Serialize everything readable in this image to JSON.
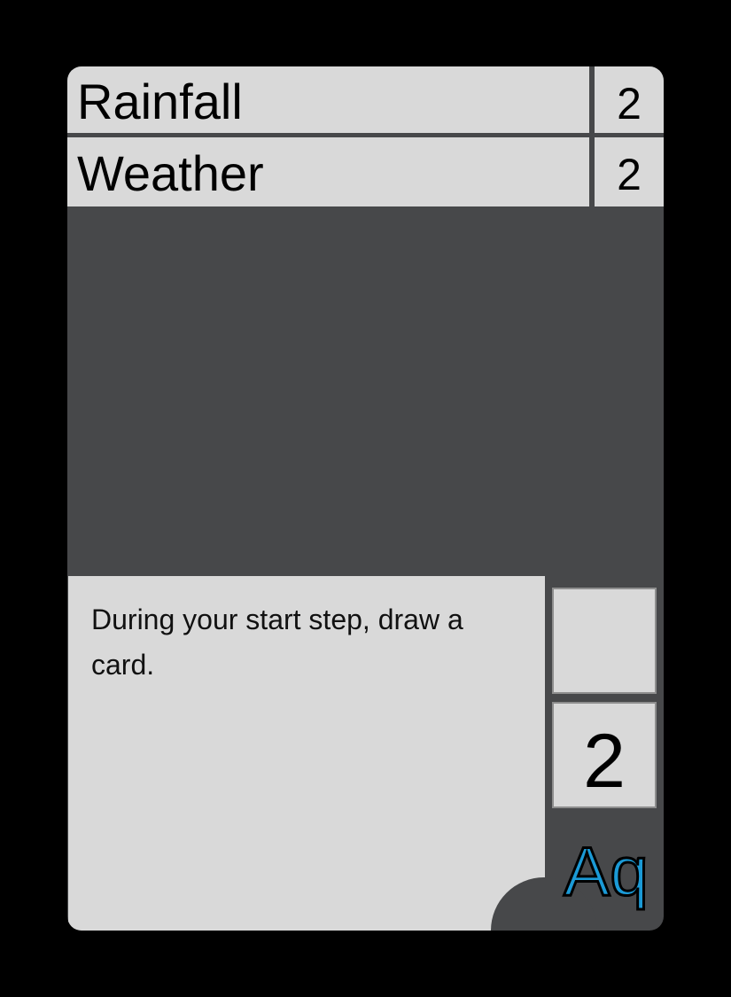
{
  "card": {
    "title": "Rainfall",
    "type_line": "Weather",
    "top_stat": "2",
    "second_stat": "2",
    "rules_text": "During your start step, draw a card.",
    "upper_stat": "",
    "lower_stat": "2",
    "set_symbol": "Aq"
  },
  "colors": {
    "card_frame": "#47484a",
    "panel": "#d9d9d9",
    "set_symbol": "#1b9ad6",
    "background": "#000000"
  }
}
